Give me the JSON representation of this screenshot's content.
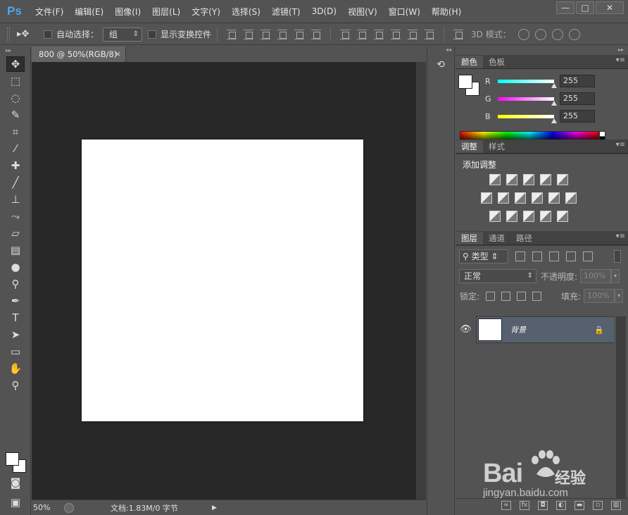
{
  "app": {
    "logo": "Ps"
  },
  "menu": [
    "文件(F)",
    "编辑(E)",
    "图像(I)",
    "图层(L)",
    "文字(Y)",
    "选择(S)",
    "滤镜(T)",
    "3D(D)",
    "视图(V)",
    "窗口(W)",
    "帮助(H)"
  ],
  "window_controls": {
    "minimize": "—",
    "maximize": "□",
    "close": "✕"
  },
  "options_bar": {
    "tool_glyph": "▸✥",
    "auto_select_label": "自动选择：",
    "auto_select_value": "组",
    "show_transform_label": "显示变换控件",
    "mode_3d_label": "3D 模式："
  },
  "document": {
    "tab_title": "800 @ 50%(RGB/8)",
    "tab_close": "×",
    "zoom": "50%",
    "doc_info": "文档:1.83M/0 字节",
    "status_arrow": "▶"
  },
  "color_panel": {
    "tabs": [
      "颜色",
      "色板"
    ],
    "channels": [
      {
        "label": "R",
        "value": "255",
        "color": "#00ffff"
      },
      {
        "label": "G",
        "value": "255",
        "color": "#ff00ff"
      },
      {
        "label": "B",
        "value": "255",
        "color": "#ffff00"
      }
    ]
  },
  "adjustments_panel": {
    "tabs": [
      "调整",
      "样式"
    ],
    "title": "添加调整"
  },
  "layers_panel": {
    "tabs": [
      "图层",
      "通道",
      "路径"
    ],
    "filter_label": "类型",
    "blend_mode": "正常",
    "opacity_label": "不透明度:",
    "opacity_value": "100%",
    "lock_label": "锁定:",
    "fill_label": "填充:",
    "fill_value": "100%",
    "layers": [
      {
        "name": "背景",
        "visible": true,
        "locked": true
      }
    ]
  },
  "watermark": {
    "brand": "Bai",
    "brand_suffix": "经验",
    "url": "jingyan.baidu.com"
  }
}
